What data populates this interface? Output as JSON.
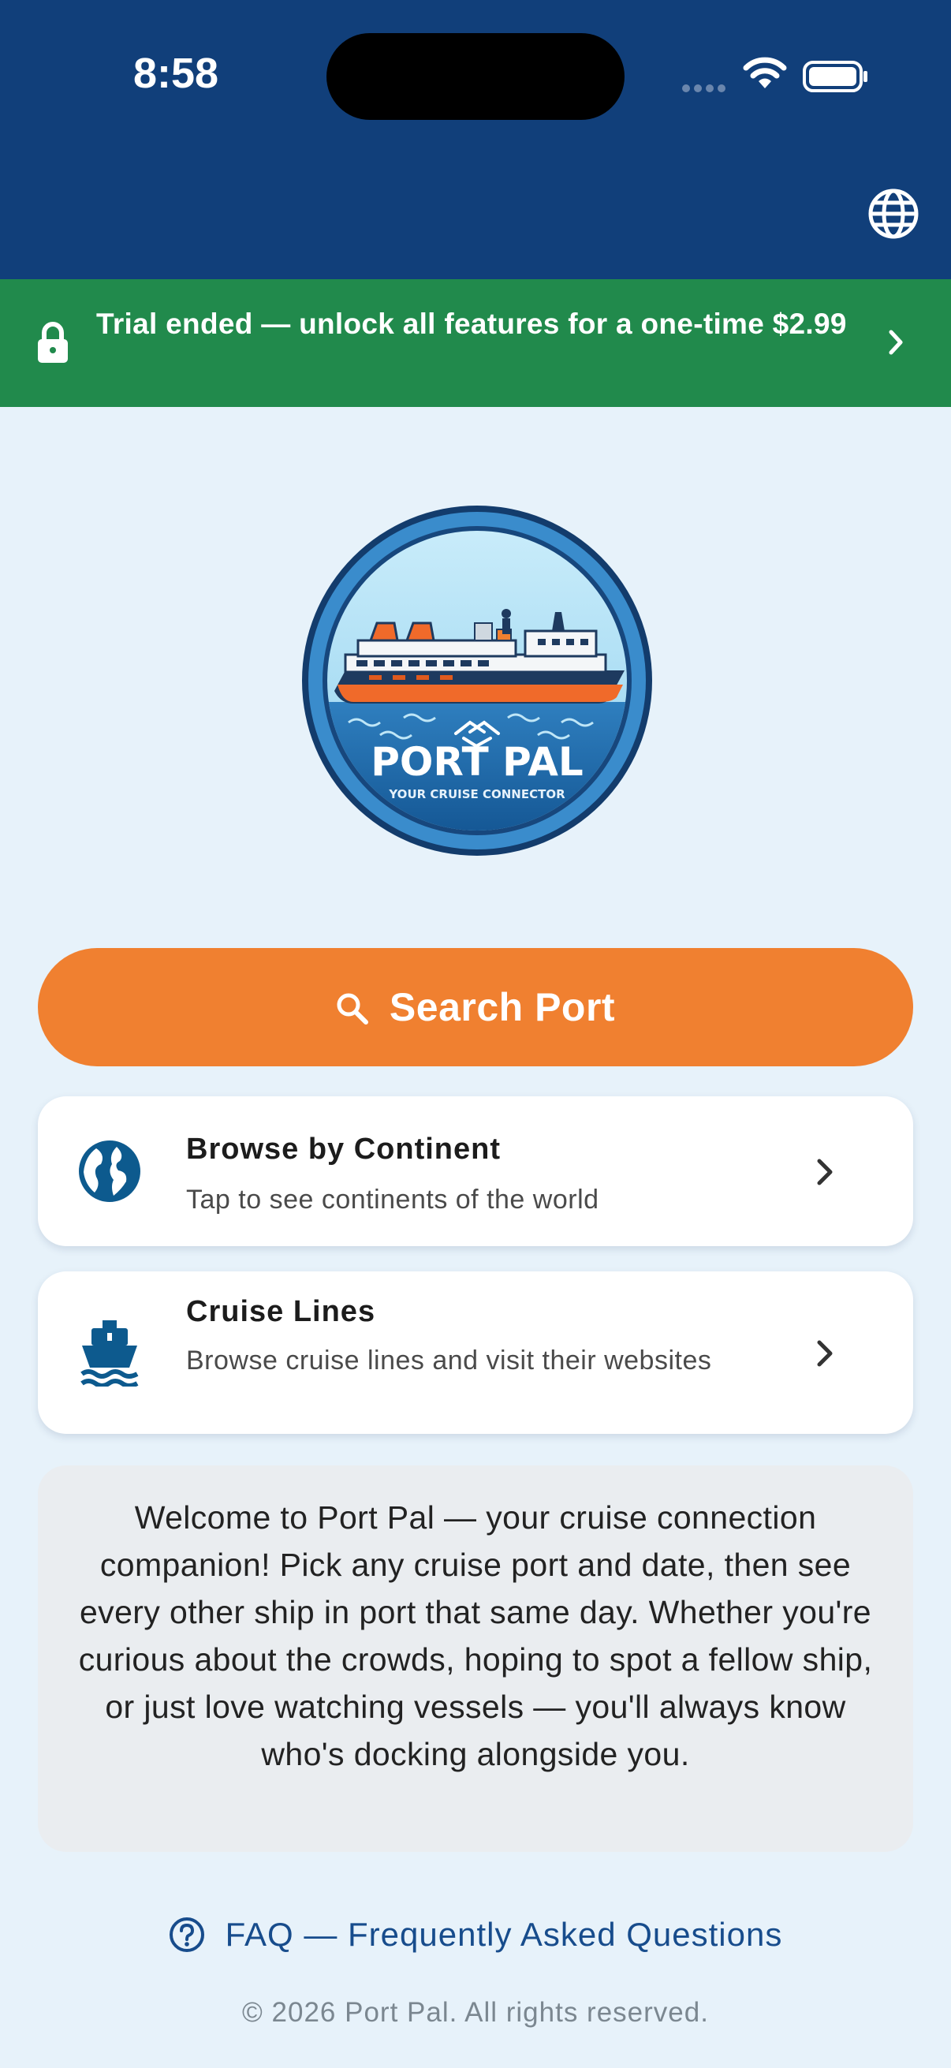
{
  "status_bar": {
    "time": "8:58"
  },
  "header": {
    "language_icon": "globe-icon"
  },
  "trial_banner": {
    "text": "Trial ended — unlock all features for a one-time $2.99",
    "icon": "lock-icon",
    "color": "#218a4c"
  },
  "logo": {
    "title": "PORT PAL",
    "tagline": "YOUR CRUISE CONNECTOR"
  },
  "search_button": {
    "label": "Search Port",
    "icon": "search-icon",
    "color": "#f08030"
  },
  "cards": [
    {
      "title": "Browse by Continent",
      "subtitle": "Tap to see continents of the world",
      "icon": "earth-icon"
    },
    {
      "title": "Cruise Lines",
      "subtitle": "Browse cruise lines and visit their websites",
      "icon": "ship-icon"
    }
  ],
  "welcome": {
    "text": "Welcome to Port Pal — your cruise connection companion! Pick any cruise port and date, then see every other ship in port that same day. Whether you're curious about the crowds, hoping to spot a fellow ship, or just love watching vessels — you'll always know who's docking alongside you."
  },
  "faq": {
    "label": "FAQ — Frequently Asked Questions",
    "icon": "help-circle-icon"
  },
  "footer": {
    "copyright": "© 2026 Port Pal. All rights reserved."
  },
  "colors": {
    "header": "#113f7a",
    "background": "#e7f2fa",
    "accent": "#f08030",
    "link": "#174c8c"
  }
}
